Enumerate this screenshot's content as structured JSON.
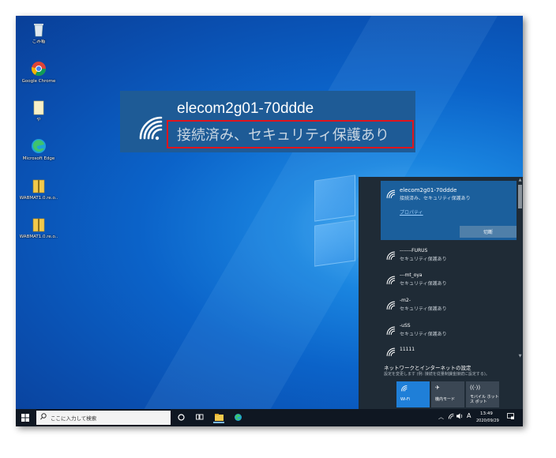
{
  "desktop": {
    "icons": [
      {
        "label": "ごみ箱",
        "icon": "recycle-bin-icon"
      },
      {
        "label": "Google Chrome",
        "icon": "chrome-icon"
      },
      {
        "label": "や",
        "icon": "folder-icon"
      },
      {
        "label": "Microsoft Edge",
        "icon": "edge-icon"
      },
      {
        "label": "WABMAT1.0.re.o..",
        "icon": "zip-folder-icon"
      },
      {
        "label": "WABMAT1.0.re.o..",
        "icon": "zip-folder-icon"
      }
    ]
  },
  "callout": {
    "ssid": "elecom2g01-70ddde",
    "status": "接続済み、セキュリティ保護あり",
    "highlight_color": "#e0141c"
  },
  "flyout": {
    "connected": {
      "ssid": "elecom2g01-70ddde",
      "status": "接続済み、セキュリティ保護あり",
      "properties_link": "プロパティ",
      "disconnect_label": "切断"
    },
    "networks": [
      {
        "ssid": "-------FURUS",
        "security": "セキュリティ保護あり"
      },
      {
        "ssid": "---mt_oya",
        "security": "セキュリティ保護あり"
      },
      {
        "ssid": "-m2-",
        "security": "セキュリティ保護あり"
      },
      {
        "ssid": "-uSS",
        "security": "セキュリティ保護あり"
      },
      {
        "ssid": "11111",
        "security": ""
      }
    ],
    "settings_title": "ネットワークとインターネットの設定",
    "settings_desc": "設定を変更します (例: 接続を従量制課金接続に設定する)。",
    "quick_actions": [
      {
        "label": "Wi-Fi",
        "icon": "wifi-icon",
        "active": true
      },
      {
        "label": "機内モード",
        "icon": "airplane-icon",
        "active": false
      },
      {
        "label": "モバイル ホットス ポット",
        "icon": "hotspot-icon",
        "active": false
      }
    ]
  },
  "taskbar": {
    "search_placeholder": "ここに入力して検索",
    "tray_ime": "A",
    "time": "13:49",
    "date": "2020/09/29"
  },
  "colors": {
    "flyout_bg": "#1f2b36",
    "connected_bg": "#1b5f9c",
    "accent": "#1f7fd8"
  }
}
